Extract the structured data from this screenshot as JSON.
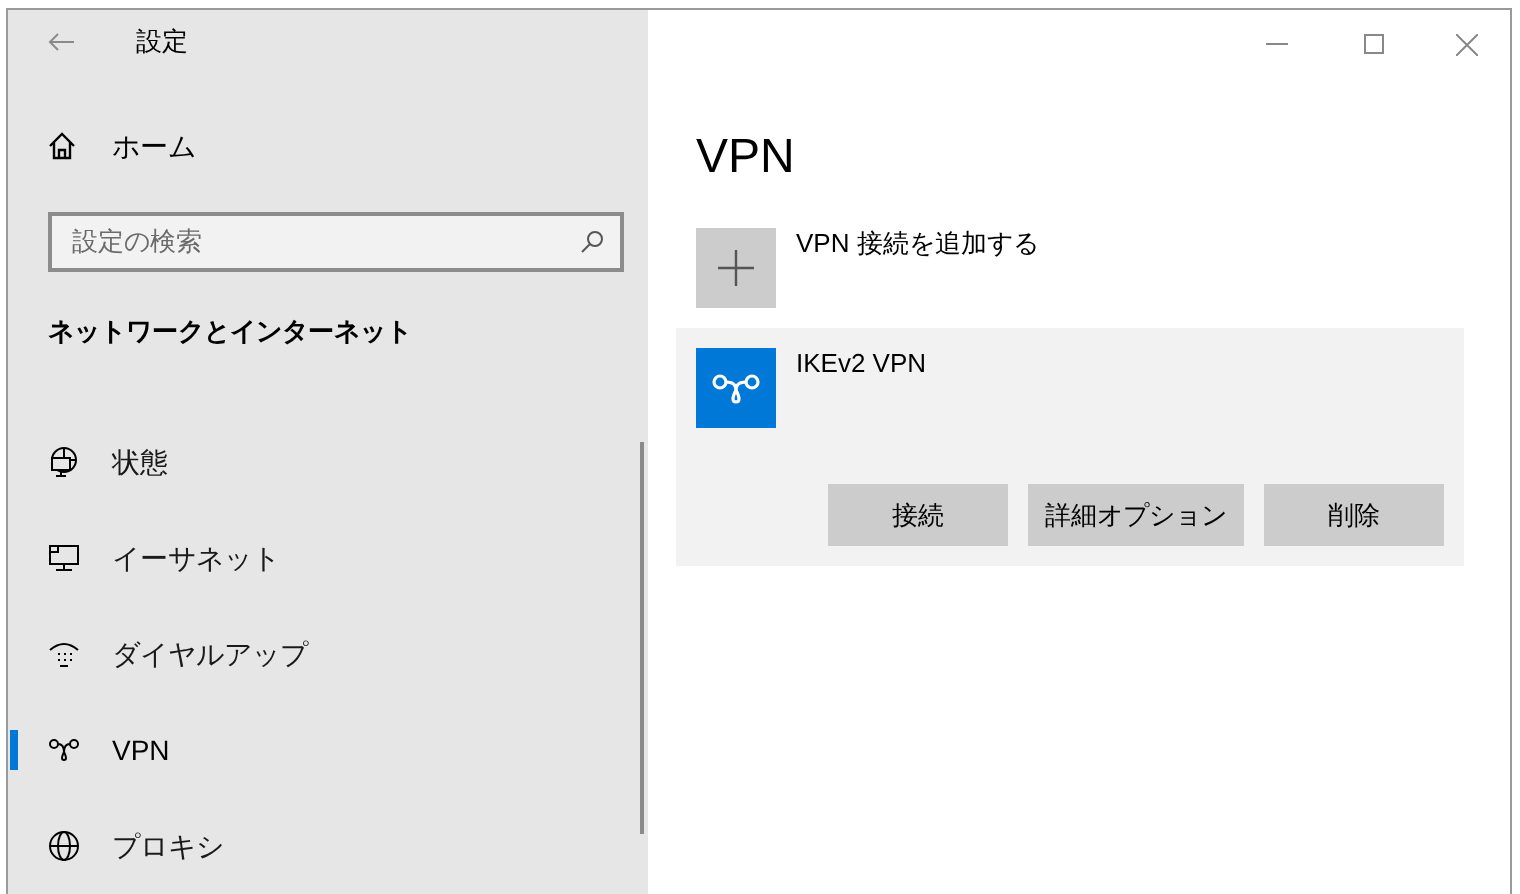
{
  "window": {
    "title": "設定"
  },
  "sidebar": {
    "home": "ホーム",
    "search": {
      "placeholder": "設定の検索"
    },
    "section": "ネットワークとインターネット",
    "items": [
      {
        "label": "状態",
        "selected": false
      },
      {
        "label": "イーサネット",
        "selected": false
      },
      {
        "label": "ダイヤルアップ",
        "selected": false
      },
      {
        "label": "VPN",
        "selected": true
      },
      {
        "label": "プロキシ",
        "selected": false
      }
    ]
  },
  "main": {
    "heading": "VPN",
    "add_label": "VPN 接続を追加する",
    "connections": [
      {
        "name": "IKEv2 VPN",
        "buttons": [
          "接続",
          "詳細オプション",
          "削除"
        ]
      }
    ]
  }
}
